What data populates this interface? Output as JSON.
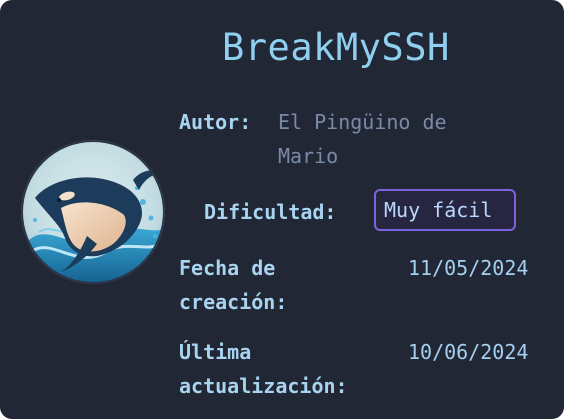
{
  "machine": {
    "title": "BreakMySSH",
    "avatar_icon": "orca-icon"
  },
  "info": {
    "author_label": "Autor:",
    "author_line1": "El Pingüino de",
    "author_line2": "Mario",
    "difficulty_label": "Dificultad:",
    "difficulty_value": "Muy fácil",
    "created_label_line1": "Fecha de",
    "created_label_line2": "creación:",
    "created_value": "11/05/2024",
    "updated_label_line1": "Última",
    "updated_label_line2": "actualización:",
    "updated_value": "10/06/2024"
  },
  "colors": {
    "background": "#222736",
    "title": "#8fd0f0",
    "badge_border": "#7c62dc"
  }
}
